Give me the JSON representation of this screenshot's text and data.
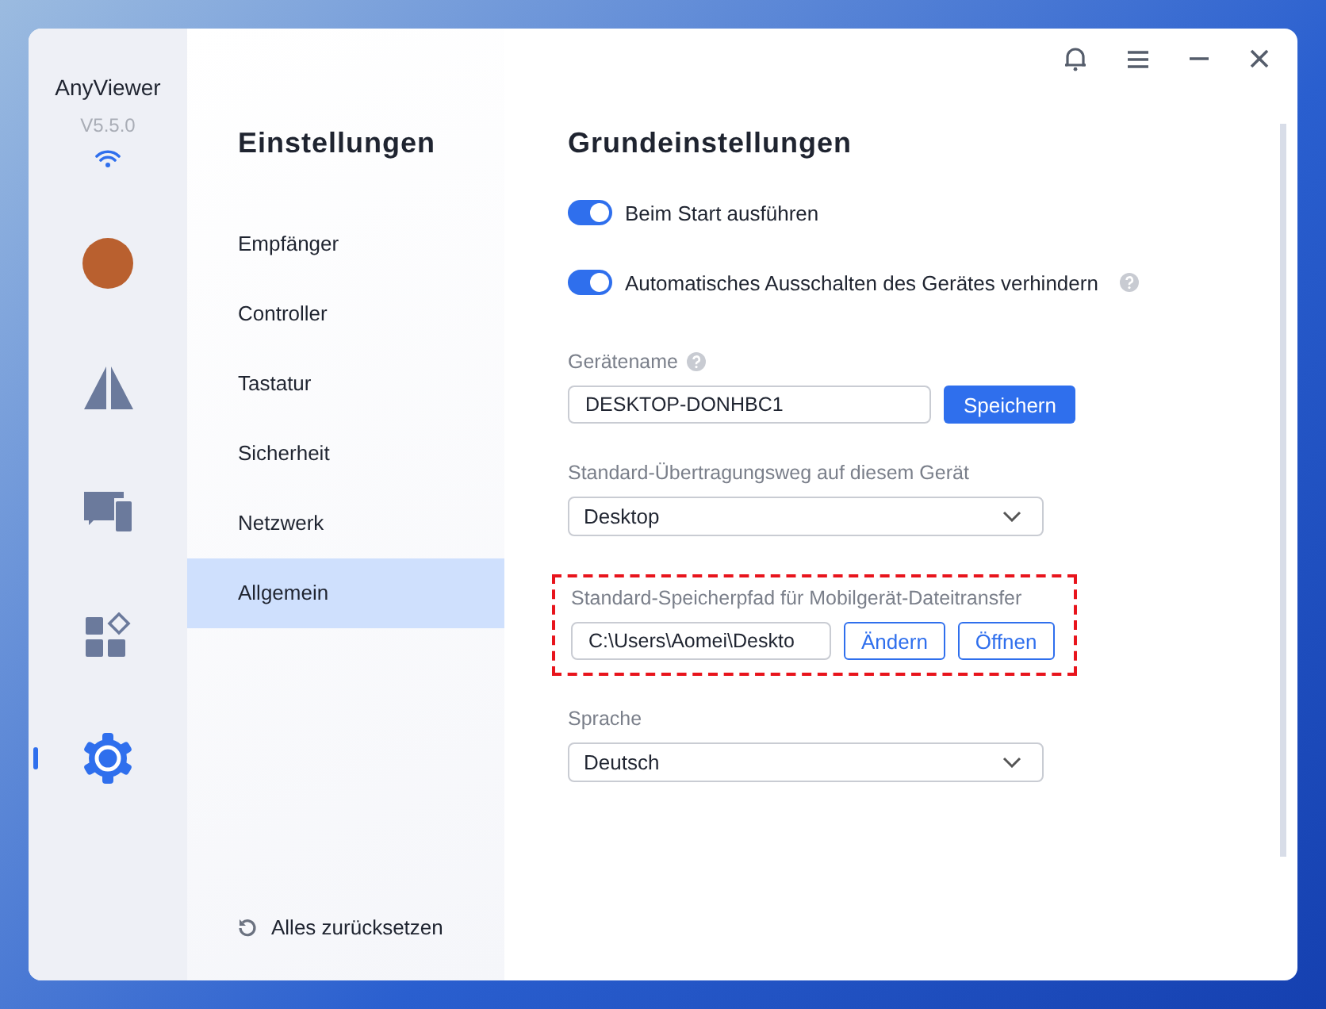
{
  "app": {
    "name": "AnyViewer",
    "version": "V5.5.0"
  },
  "sidebar": {
    "items": [
      {
        "kind": "avatar",
        "selected": false
      },
      {
        "kind": "mirror",
        "selected": false
      },
      {
        "kind": "devices",
        "selected": false
      },
      {
        "kind": "apps",
        "selected": false
      },
      {
        "kind": "gear",
        "selected": true
      }
    ]
  },
  "nav": {
    "title": "Einstellungen",
    "items": [
      {
        "label": "Empfänger",
        "selected": false
      },
      {
        "label": "Controller",
        "selected": false
      },
      {
        "label": "Tastatur",
        "selected": false
      },
      {
        "label": "Sicherheit",
        "selected": false
      },
      {
        "label": "Netzwerk",
        "selected": false
      },
      {
        "label": "Allgemein",
        "selected": true
      }
    ],
    "reset": "Alles zurücksetzen"
  },
  "content": {
    "title": "Grundeinstellungen",
    "settings": [
      {
        "kind": "toggle",
        "label": "Beim Start ausführen",
        "on": true,
        "help": false
      },
      {
        "kind": "toggle",
        "label": "Automatisches Ausschalten des Gerätes verhindern",
        "on": true,
        "help": true
      },
      {
        "kind": "input",
        "label": "Gerätename",
        "help": true,
        "value": "DESKTOP-DONHBC1",
        "buttons": [
          {
            "label": "Speichern",
            "primary": true
          }
        ],
        "highlighted": false
      },
      {
        "kind": "select",
        "label": "Standard-Übertragungsweg auf diesem Gerät",
        "value": "Desktop",
        "highlighted": false
      },
      {
        "kind": "input",
        "label": "Standard-Speicherpfad für Mobilgerät-Dateitransfer",
        "help": false,
        "value": "C:\\Users\\Aomei\\Deskto",
        "buttons": [
          {
            "label": "Ändern",
            "primary": false
          },
          {
            "label": "Öffnen",
            "primary": false
          }
        ],
        "highlighted": true
      },
      {
        "kind": "select",
        "label": "Sprache",
        "value": "Deutsch",
        "highlighted": false
      }
    ]
  }
}
